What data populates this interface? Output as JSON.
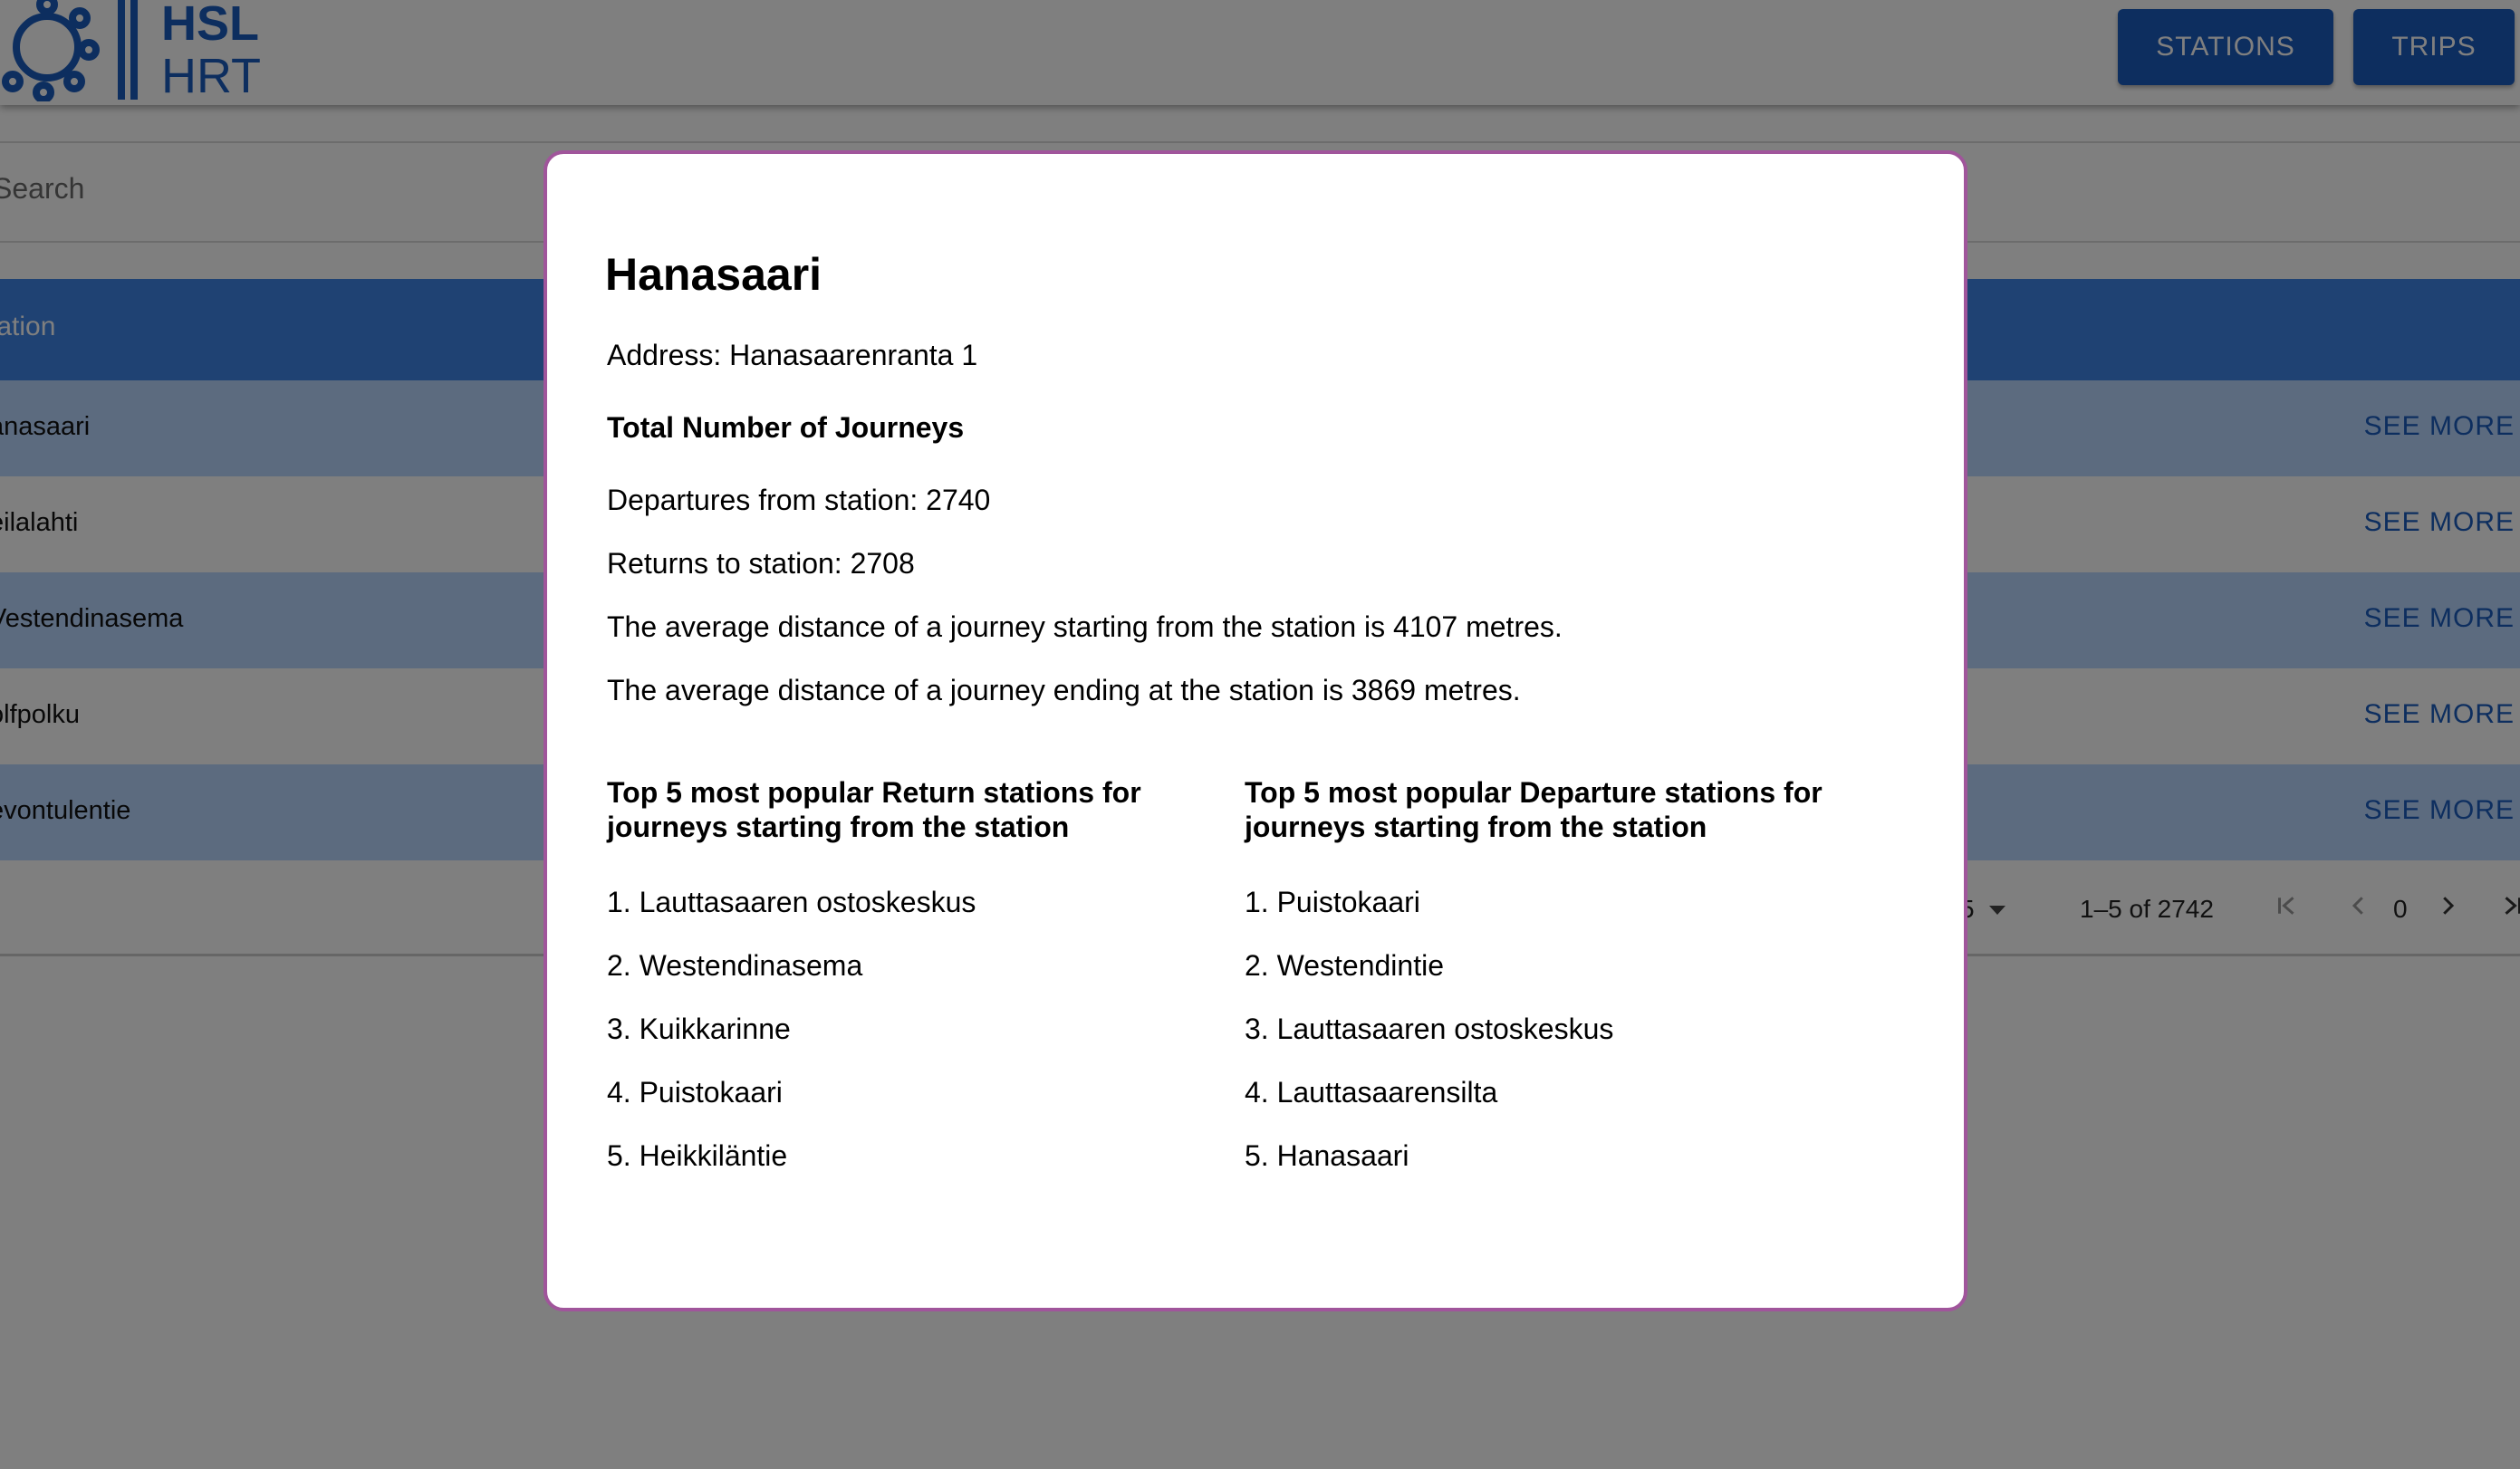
{
  "header": {
    "logo_text_top": "HSL",
    "logo_text_bottom": "HRT",
    "nav": {
      "stations_label": "STATIONS",
      "trips_label": "TRIPS"
    }
  },
  "search": {
    "placeholder": "Search"
  },
  "table": {
    "column_header": "tation",
    "rows": [
      {
        "name": "anasaari",
        "action": "SEE MORE"
      },
      {
        "name": "eilalahti",
        "action": "SEE MORE"
      },
      {
        "name": "Vestendinasema",
        "action": "SEE MORE"
      },
      {
        "name": "olfpolku",
        "action": "SEE MORE"
      },
      {
        "name": "evontulentie",
        "action": "SEE MORE"
      }
    ],
    "pagination": {
      "rows_per_page_value": "5",
      "range_text": "1–5 of 2742",
      "page_number": "0"
    }
  },
  "modal": {
    "title": "Hanasaari",
    "address": "Address: Hanasaarenranta 1",
    "total_heading": "Total Number of Journeys",
    "departures": "Departures from station: 2740",
    "returns": "Returns to station: 2708",
    "avg_start": "The average distance of a journey starting from the station is 4107 metres.",
    "avg_end": "The average distance of a journey ending at the station is 3869 metres.",
    "top_return": {
      "heading": "Top 5 most popular Return stations for journeys starting from the station",
      "items": [
        "1. Lauttasaaren ostoskeskus",
        "2. Westendinasema",
        "3. Kuikkarinne",
        "4. Puistokaari",
        "5. Heikkiläntie"
      ]
    },
    "top_departure": {
      "heading": "Top 5 most popular Departure stations for journeys starting from the station",
      "items": [
        "1. Puistokaari",
        "2. Westendintie",
        "3. Lauttasaaren ostoskeskus",
        "4. Lauttasaarensilta",
        "5. Hanasaari"
      ]
    }
  },
  "colors": {
    "primary": "#1b5dbf",
    "header_row": "#3f85e6",
    "odd_row": "#b9d6ff",
    "modal_border": "#a0559b",
    "backdrop": "rgba(0,0,0,0.5)"
  }
}
